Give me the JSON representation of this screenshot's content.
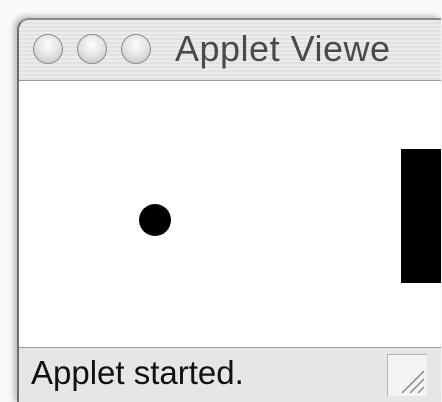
{
  "window": {
    "title": "Applet Viewe"
  },
  "status": {
    "text": "Applet started."
  },
  "colors": {
    "ball": "#000000",
    "paddle": "#000000",
    "background": "#ffffff",
    "statusbar": "#e6e6e6"
  },
  "icons": {
    "close": "close-icon",
    "minimize": "minimize-icon",
    "zoom": "zoom-icon",
    "resize": "resize-grip-icon"
  }
}
